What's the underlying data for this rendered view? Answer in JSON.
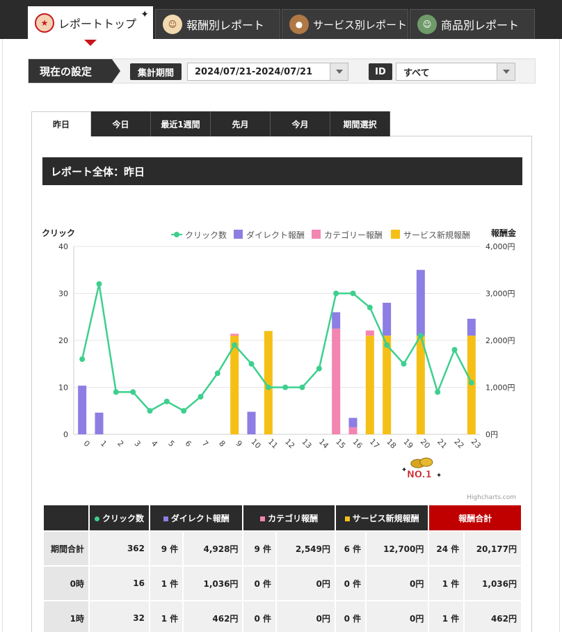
{
  "top_tabs": [
    {
      "label": "レポートトップ",
      "icon": "kabuto-character-icon",
      "active": true
    },
    {
      "label": "報酬別レポート",
      "icon": "girl-character-icon",
      "active": false
    },
    {
      "label": "サービス別レポート",
      "icon": "bear-character-icon",
      "active": false
    },
    {
      "label": "商品別レポート",
      "icon": "kappa-character-icon",
      "active": false
    }
  ],
  "settings": {
    "label": "現在の設定",
    "period_label": "集計期間",
    "period_value": "2024/07/21-2024/07/21",
    "id_label": "ID",
    "id_value": "すべて"
  },
  "period_tabs": [
    "昨日",
    "今日",
    "最近1週間",
    "先月",
    "今月",
    "期間選択"
  ],
  "report_title": "レポート全体：昨日",
  "colors": {
    "clicks": "#3ecf8e",
    "direct": "#8c7ee3",
    "category": "#f285b1",
    "service": "#f5c016",
    "total_header": "#c00000",
    "dark": "#2b2b2b"
  },
  "chart_data": {
    "type": "bar",
    "y_left_label": "クリック",
    "y_right_label": "報酬金",
    "y_left_range": [
      0,
      40
    ],
    "y_left_ticks": [
      "0",
      "10",
      "20",
      "30",
      "40"
    ],
    "y_right_range": [
      0,
      4000
    ],
    "y_right_ticks": [
      "0円",
      "1,000円",
      "2,000円",
      "3,000円",
      "4,000円"
    ],
    "categories": [
      "0",
      "1",
      "2",
      "3",
      "4",
      "5",
      "6",
      "7",
      "8",
      "9",
      "10",
      "11",
      "12",
      "13",
      "14",
      "15",
      "16",
      "17",
      "18",
      "19",
      "20",
      "21",
      "22",
      "23"
    ],
    "series": [
      {
        "name": "クリック数",
        "type": "line",
        "axis": "left",
        "values": [
          16,
          32,
          9,
          9,
          5,
          7,
          5,
          8,
          13,
          19,
          15,
          10,
          10,
          10,
          14,
          30,
          30,
          27,
          19,
          15,
          21,
          9,
          18,
          11
        ]
      },
      {
        "name": "ダイレクト報酬",
        "type": "column",
        "axis": "right",
        "values": [
          1036,
          462,
          0,
          0,
          0,
          0,
          0,
          0,
          0,
          0,
          480,
          0,
          0,
          0,
          0,
          350,
          200,
          0,
          700,
          0,
          1400,
          0,
          0,
          360
        ]
      },
      {
        "name": "カテゴリー報酬",
        "type": "column",
        "axis": "right",
        "values": [
          0,
          0,
          0,
          0,
          0,
          0,
          0,
          0,
          0,
          40,
          0,
          0,
          0,
          0,
          0,
          2249,
          150,
          110,
          0,
          0,
          0,
          0,
          0,
          0
        ]
      },
      {
        "name": "サービス新規報酬",
        "type": "column",
        "axis": "right",
        "values": [
          0,
          0,
          0,
          0,
          0,
          0,
          0,
          0,
          0,
          2100,
          0,
          2200,
          0,
          0,
          0,
          0,
          0,
          2100,
          2100,
          0,
          2100,
          0,
          0,
          2100
        ]
      }
    ],
    "badge": {
      "category": "20",
      "label": "NO.1"
    },
    "legend_position": "top-right",
    "credits": "Highcharts.com"
  },
  "table": {
    "headers": [
      "クリック数",
      "ダイレクト報酬",
      "カテゴリ報酬",
      "サービス新規報酬",
      "報酬合計"
    ],
    "rows": [
      {
        "label": "期間合計",
        "clicks": "362",
        "direct_n": "9 件",
        "direct_y": "4,928円",
        "cat_n": "9 件",
        "cat_y": "2,549円",
        "svc_n": "6 件",
        "svc_y": "12,700円",
        "tot_n": "24 件",
        "tot_y": "20,177円"
      },
      {
        "label": "0時",
        "clicks": "16",
        "direct_n": "1 件",
        "direct_y": "1,036円",
        "cat_n": "0 件",
        "cat_y": "0円",
        "svc_n": "0 件",
        "svc_y": "0円",
        "tot_n": "1 件",
        "tot_y": "1,036円"
      },
      {
        "label": "1時",
        "clicks": "32",
        "direct_n": "1 件",
        "direct_y": "462円",
        "cat_n": "0 件",
        "cat_y": "0円",
        "svc_n": "0 件",
        "svc_y": "0円",
        "tot_n": "1 件",
        "tot_y": "462円"
      }
    ]
  }
}
